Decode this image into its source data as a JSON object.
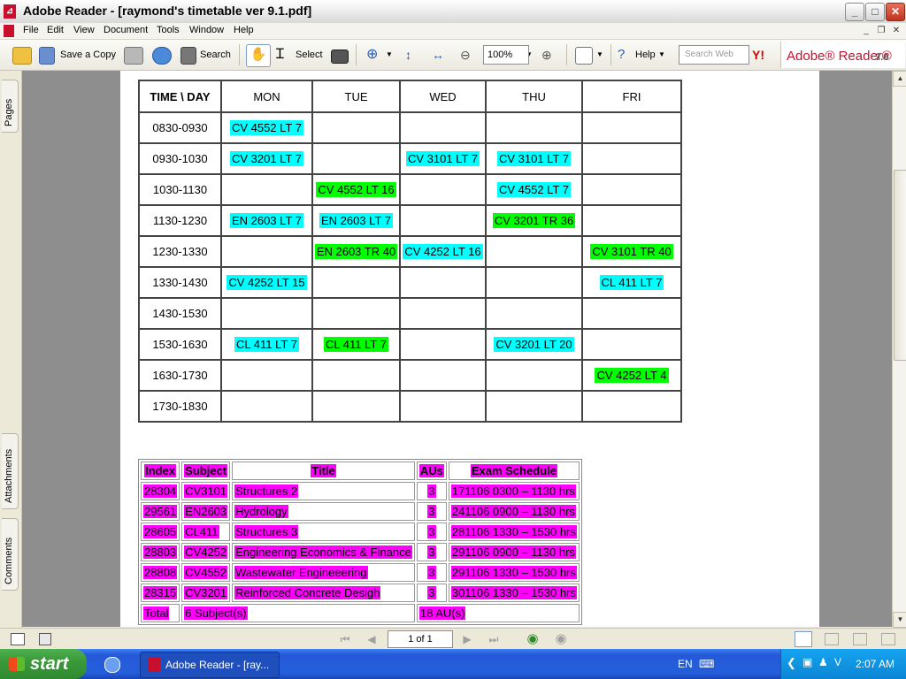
{
  "window": {
    "title": "Adobe Reader - [raymond's timetable ver 9.1.pdf]",
    "minimize": "_",
    "maximize": "□",
    "close": "✕"
  },
  "menu": {
    "items": [
      "File",
      "Edit",
      "View",
      "Document",
      "Tools",
      "Window",
      "Help"
    ],
    "mdi_minimize": "_",
    "mdi_restore": "❐",
    "mdi_close": "✕"
  },
  "toolbar": {
    "save_copy": "Save a Copy",
    "search": "Search",
    "select": "Select",
    "zoom": "100%",
    "help": "Help",
    "search_web_placeholder": "Search Web",
    "yahoo": "Y!",
    "brand": "Adobe® Reader®",
    "brand_version": "7.0"
  },
  "nav_tabs": {
    "pages": "Pages",
    "attachments": "Attachments",
    "comments": "Comments"
  },
  "timetable": {
    "header": [
      "TIME \\ DAY",
      "MON",
      "TUE",
      "WED",
      "THU",
      "FRI"
    ],
    "rows": [
      {
        "time": "0830-0930",
        "cells": [
          {
            "text": "CV 4552 LT 7",
            "color": "cyan"
          },
          null,
          null,
          null,
          null
        ]
      },
      {
        "time": "0930-1030",
        "cells": [
          {
            "text": "CV 3201 LT 7",
            "color": "cyan"
          },
          null,
          {
            "text": "CV 3101 LT 7",
            "color": "cyan"
          },
          {
            "text": "CV 3101 LT 7",
            "color": "cyan"
          },
          null
        ]
      },
      {
        "time": "1030-1130",
        "cells": [
          null,
          {
            "text": "CV 4552 LT 16",
            "color": "green"
          },
          null,
          {
            "text": "CV 4552 LT 7",
            "color": "cyan"
          },
          null
        ]
      },
      {
        "time": "1130-1230",
        "cells": [
          {
            "text": "EN 2603 LT 7",
            "color": "cyan"
          },
          {
            "text": "EN 2603 LT 7",
            "color": "cyan"
          },
          null,
          {
            "text": "CV 3201 TR 36",
            "color": "green"
          },
          null
        ]
      },
      {
        "time": "1230-1330",
        "cells": [
          null,
          {
            "text": "EN 2603 TR 40",
            "color": "green"
          },
          {
            "text": "CV 4252 LT 16",
            "color": "cyan"
          },
          null,
          {
            "text": "CV 3101 TR 40",
            "color": "green"
          }
        ]
      },
      {
        "time": "1330-1430",
        "cells": [
          {
            "text": "CV 4252 LT 15",
            "color": "cyan"
          },
          null,
          null,
          null,
          {
            "text": "CL 411 LT 7",
            "color": "cyan"
          }
        ]
      },
      {
        "time": "1430-1530",
        "cells": [
          null,
          null,
          null,
          null,
          null
        ]
      },
      {
        "time": "1530-1630",
        "cells": [
          {
            "text": "CL 411 LT 7",
            "color": "cyan"
          },
          {
            "text": "CL 411 LT 7",
            "color": "green"
          },
          null,
          {
            "text": "CV 3201 LT 20",
            "color": "cyan"
          },
          null
        ]
      },
      {
        "time": "1630-1730",
        "cells": [
          null,
          null,
          null,
          null,
          {
            "text": "CV 4252 LT 4",
            "color": "green"
          }
        ]
      },
      {
        "time": "1730-1830",
        "cells": [
          null,
          null,
          null,
          null,
          null
        ]
      }
    ]
  },
  "exam_table": {
    "header": [
      "Index",
      "Subject",
      "Title",
      "AUs",
      "Exam Schedule"
    ],
    "rows": [
      [
        "28304",
        "CV3101",
        "Structures 2",
        "3",
        "171106 0300 – 1130 hrs"
      ],
      [
        "29561",
        "EN2603",
        "Hydrology",
        "3",
        "241106 0900 – 1130 hrs"
      ],
      [
        "28605",
        "CL411",
        "Structures 3",
        "3",
        "281106 1330 – 1530 hrs"
      ],
      [
        "28803",
        "CV4252",
        "Engineering Economics & Finance",
        "3",
        "291106 0900 – 1130 hrs"
      ],
      [
        "28808",
        "CV4552",
        "Wastewater Engineeering",
        "3",
        "291106 1330 – 1530 hrs"
      ],
      [
        "28315",
        "CV3201",
        "Reinforced Concrete Desigh",
        "3",
        "301106 1330 – 1530 hrs"
      ]
    ],
    "total": {
      "label": "Total",
      "subjects": "6 Subject(s)",
      "aus": "18 AU(s)"
    }
  },
  "statusbar": {
    "page_indicator": "1 of 1"
  },
  "taskbar": {
    "start": "start",
    "task_label": "Adobe Reader - [ray...",
    "lang": "EN",
    "clock": "2:07 AM"
  },
  "colors": {
    "cyan": "#00ffff",
    "green": "#00ff00",
    "magenta": "#ff00ff",
    "xp_blue": "#245edb",
    "adobe_red": "#c8102e"
  }
}
